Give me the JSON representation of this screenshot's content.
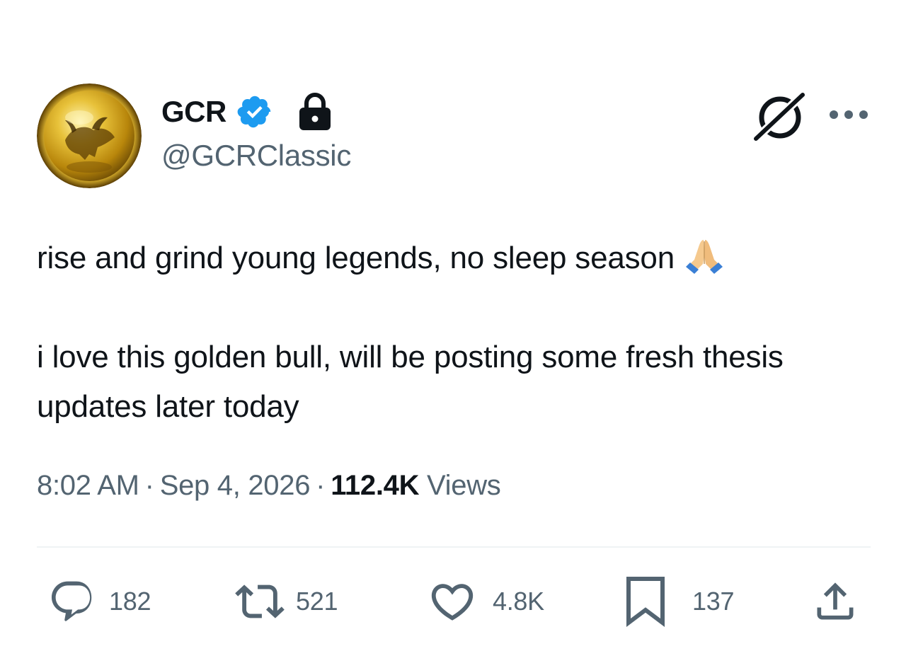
{
  "author": {
    "display_name": "GCR",
    "handle": "@GCRClassic",
    "verified_icon": "verified-badge-icon",
    "protected_icon": "lock-icon",
    "avatar": "golden-bull-coin-avatar"
  },
  "header_actions": {
    "grok_icon": "grok-icon",
    "more_icon": "more-options-icon"
  },
  "tweet": {
    "paragraph_1": "rise and grind young legends, no sleep season",
    "paragraph_1_emoji": "folded-hands-emoji",
    "paragraph_2": "i love this golden bull, will be posting some fresh thesis updates later today"
  },
  "meta": {
    "time": "8:02 AM",
    "separator": "·",
    "date": "Sep 4, 2026",
    "views_count": "112.4K",
    "views_label": "Views"
  },
  "actions": {
    "replies": "182",
    "retweets": "521",
    "likes": "4.8K",
    "bookmarks": "137"
  },
  "colors": {
    "text_primary": "#0f1419",
    "text_secondary": "#536471",
    "verified_blue": "#1d9bf0",
    "divider": "#eff3f4",
    "avatar_gold": "#c9a227"
  }
}
